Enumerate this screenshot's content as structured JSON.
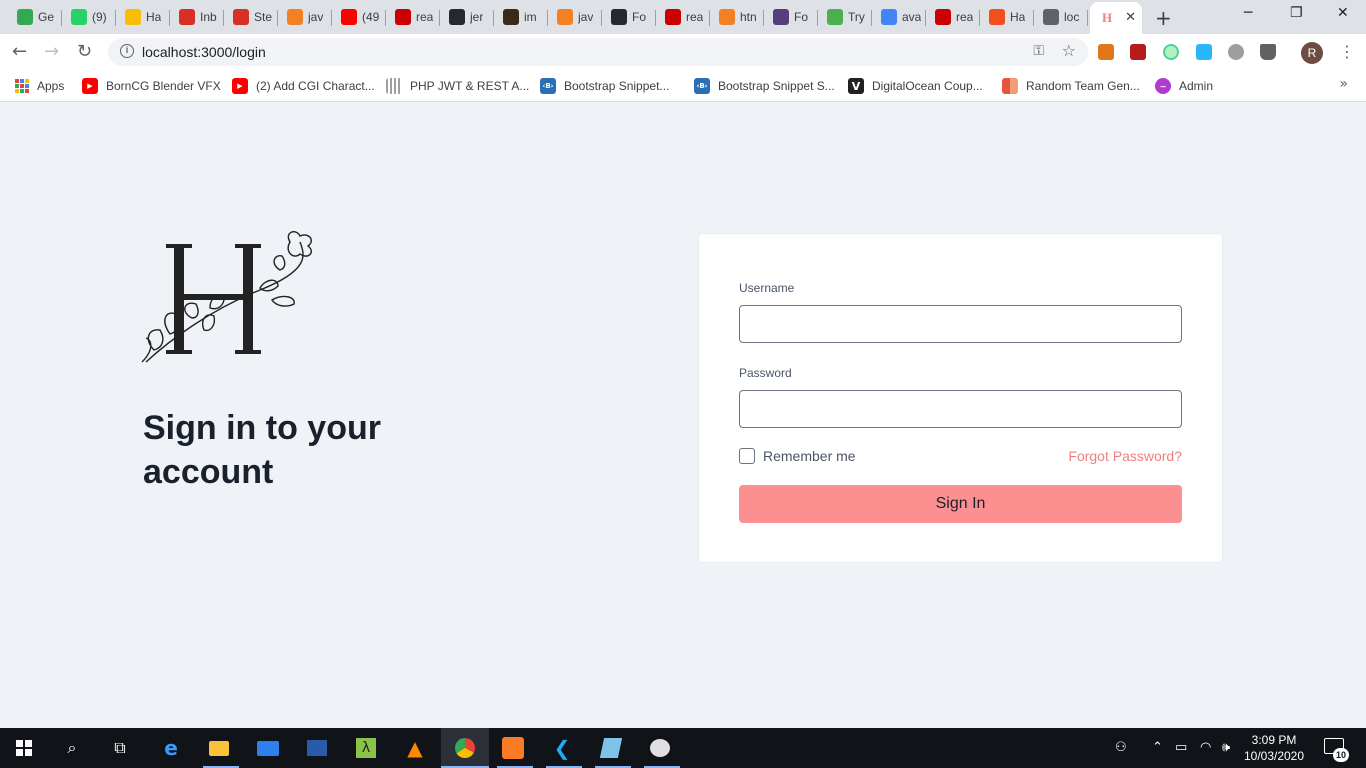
{
  "browser": {
    "tabs": [
      {
        "label": "Ge",
        "icon": "green-diamond-icon",
        "color": "#34a853"
      },
      {
        "label": "(9)",
        "icon": "whatsapp-icon",
        "color": "#25d366"
      },
      {
        "label": "Ha",
        "icon": "drive-icon",
        "color": "#fbbc04"
      },
      {
        "label": "Inb",
        "icon": "gmail-icon",
        "color": "#d93025"
      },
      {
        "label": "Ste",
        "icon": "gmail-icon",
        "color": "#d93025"
      },
      {
        "label": "jav",
        "icon": "stackoverflow-icon",
        "color": "#f48024"
      },
      {
        "label": "(49",
        "icon": "youtube-icon",
        "color": "#ff0000"
      },
      {
        "label": "rea",
        "icon": "npm-icon",
        "color": "#cb0000"
      },
      {
        "label": "jer",
        "icon": "github-icon",
        "color": "#24292e"
      },
      {
        "label": "im",
        "icon": "image-icon",
        "color": "#3a2a1a"
      },
      {
        "label": "jav",
        "icon": "stackoverflow-icon",
        "color": "#f48024"
      },
      {
        "label": "Fo",
        "icon": "github-icon",
        "color": "#24292e"
      },
      {
        "label": "rea",
        "icon": "npm-icon",
        "color": "#cb0000"
      },
      {
        "label": "htn",
        "icon": "stackoverflow-icon",
        "color": "#f48024"
      },
      {
        "label": "Fo",
        "icon": "bootstrap-icon",
        "color": "#563d7c"
      },
      {
        "label": "Try",
        "icon": "w3schools-icon",
        "color": "#4caf50"
      },
      {
        "label": "ava",
        "icon": "google-icon",
        "color": "#4285f4"
      },
      {
        "label": "rea",
        "icon": "npm-icon",
        "color": "#cb0000"
      },
      {
        "label": "Ha",
        "icon": "figma-icon",
        "color": "#f24e1e"
      },
      {
        "label": "loc",
        "icon": "globe-icon",
        "color": "#5f6368"
      }
    ],
    "active_tab_icon": "H",
    "new_tab_symbol": "+",
    "url": "localhost:3000/login",
    "profile_initial": "R",
    "bookmarks": [
      {
        "label": "Apps",
        "icon": "apps-grid-icon"
      },
      {
        "label": "BornCG Blender VFX",
        "icon": "youtube-icon"
      },
      {
        "label": "(2) Add CGI Charact...",
        "icon": "youtube-icon"
      },
      {
        "label": "PHP JWT & REST A...",
        "icon": "php-icon"
      },
      {
        "label": "Bootstrap Snippet...",
        "icon": "bootstrap-snippet-icon"
      },
      {
        "label": "Bootstrap Snippet S...",
        "icon": "bootstrap-snippet-icon"
      },
      {
        "label": "DigitalOcean Coup...",
        "icon": "digitalocean-v-icon"
      },
      {
        "label": "Random Team Gen...",
        "icon": "random-team-icon"
      },
      {
        "label": "Admin",
        "icon": "admin-icon"
      }
    ]
  },
  "login": {
    "heading": "Sign in to your account",
    "username_label": "Username",
    "password_label": "Password",
    "remember_label": "Remember me",
    "forgot_label": "Forgot Password?",
    "submit_label": "Sign In",
    "colors": {
      "accent": "#fc9090",
      "link": "#f08080",
      "heading": "#1a202c"
    }
  },
  "taskbar": {
    "time": "3:09 PM",
    "date": "10/03/2020",
    "notification_count": "10"
  }
}
